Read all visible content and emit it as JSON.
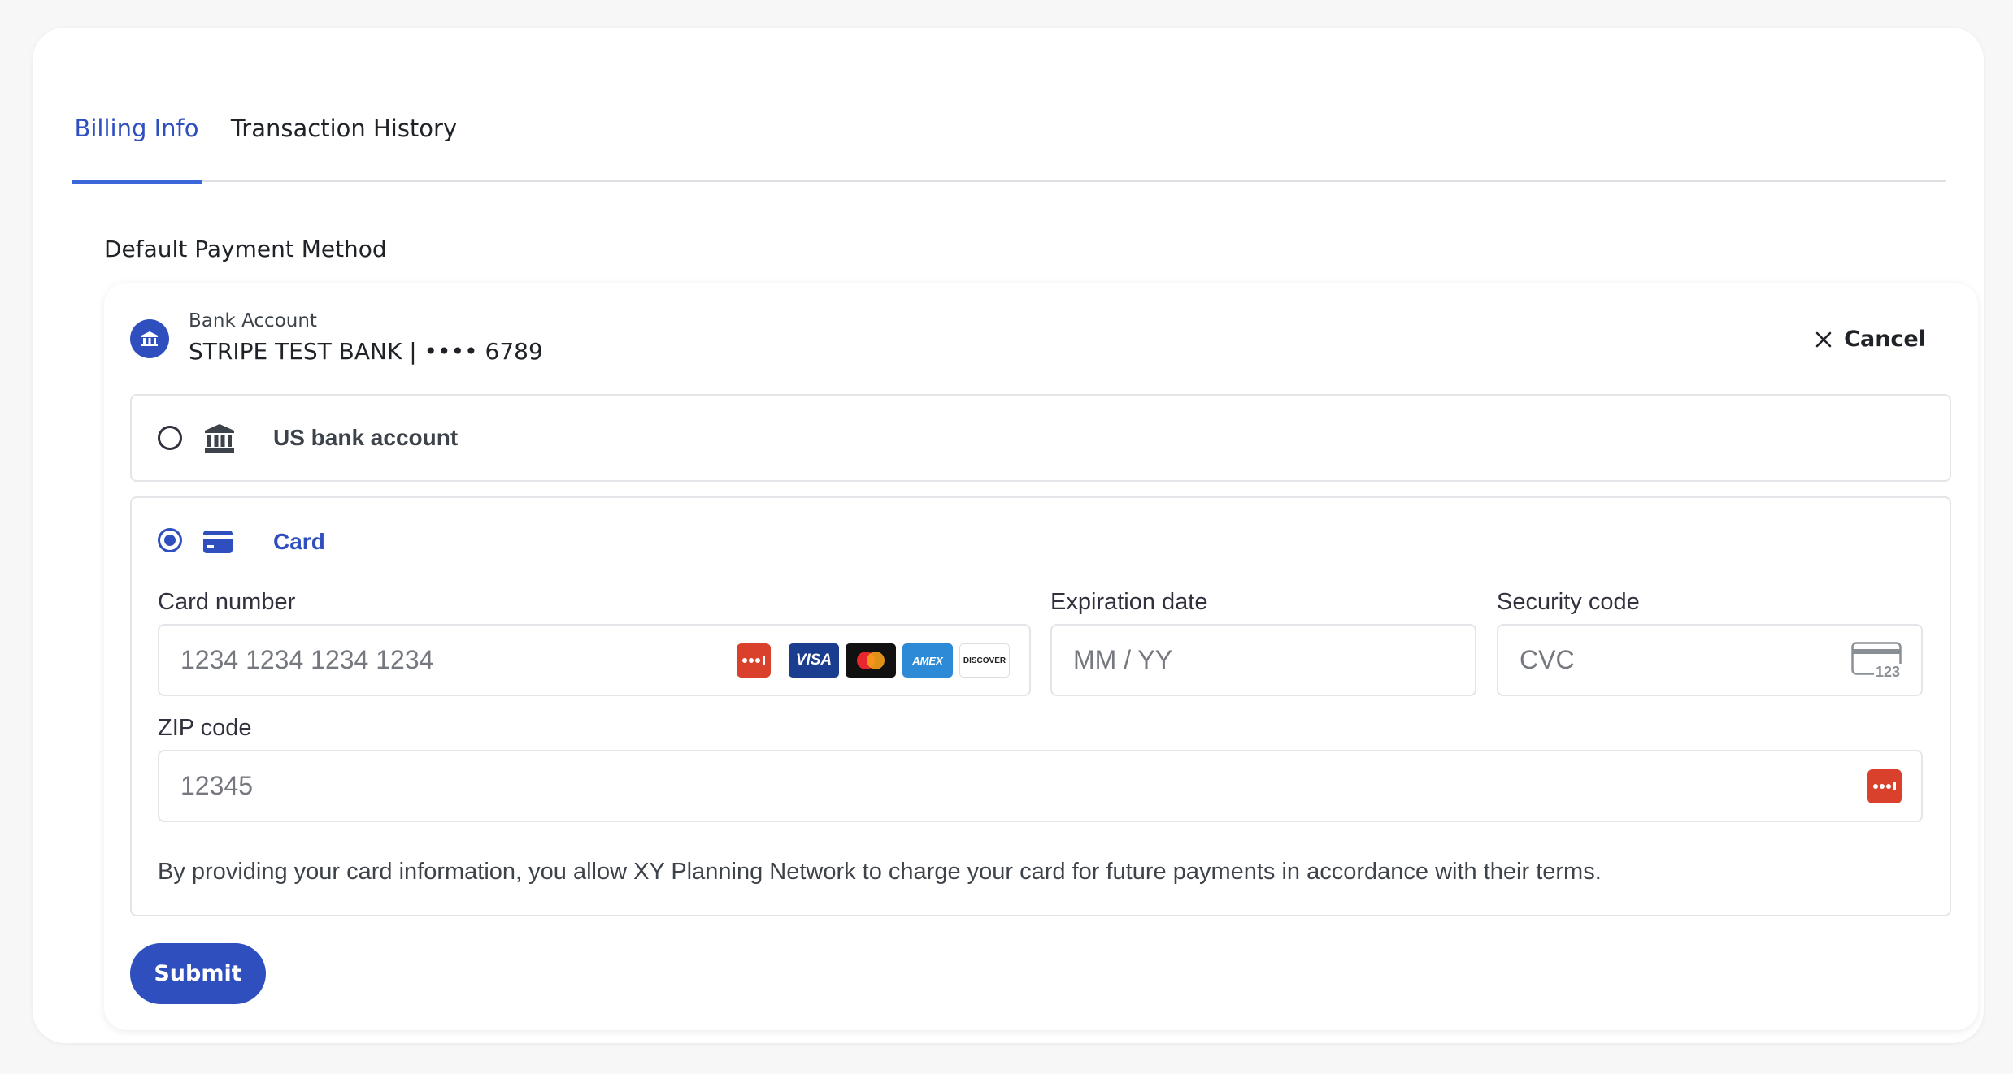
{
  "tabs": [
    {
      "label": "Billing Info",
      "active": true
    },
    {
      "label": "Transaction History",
      "active": false
    }
  ],
  "section_title": "Default Payment Method",
  "account": {
    "kind": "Bank Account",
    "name": "STRIPE TEST BANK | •••• 6789",
    "icon": "bank-icon"
  },
  "cancel_label": "Cancel",
  "options": {
    "bank": {
      "label": "US bank account",
      "selected": false,
      "icon": "bank-building-icon"
    },
    "card": {
      "label": "Card",
      "selected": true,
      "icon": "credit-card-icon"
    }
  },
  "card_form": {
    "card_number": {
      "label": "Card number",
      "placeholder": "1234 1234 1234 1234"
    },
    "expiration": {
      "label": "Expiration date",
      "placeholder": "MM / YY"
    },
    "security": {
      "label": "Security code",
      "placeholder": "CVC",
      "icon_text": "123"
    },
    "zip": {
      "label": "ZIP code",
      "placeholder": "12345"
    },
    "brands": {
      "visa": "VISA",
      "amex": "AMEX",
      "discover": "DISCOVER"
    },
    "disclaimer": "By providing your card information, you allow XY Planning Network to charge your card for future payments in accordance with their terms."
  },
  "submit_label": "Submit",
  "colors": {
    "accent": "#2f4fbf",
    "autofill_badge": "#d9412c"
  }
}
